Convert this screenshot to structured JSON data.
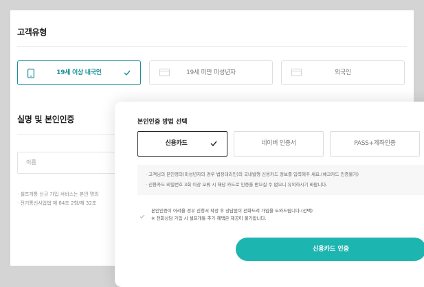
{
  "customer_type": {
    "title": "고객유형",
    "options": [
      {
        "label": "19세 이상 내국인",
        "icon": "phone-icon",
        "selected": true
      },
      {
        "label": "19세 미만 미성년자",
        "icon": "card-icon",
        "selected": false
      },
      {
        "label": "외국인",
        "icon": "card-icon",
        "selected": false
      }
    ]
  },
  "identity": {
    "title": "실명 및 본인인증",
    "name_placeholder": "이름",
    "notes": [
      "· 셀프개통 신규 가입 서비스는 본인 명의",
      "· 전기통신사업법 제 84조 2항/제 32조"
    ]
  },
  "modal": {
    "title": "본인인증 방법 선택",
    "methods": [
      {
        "label": "신용카드",
        "selected": true
      },
      {
        "label": "네이버 인증서",
        "selected": false
      },
      {
        "label": "PASS+계좌인증",
        "selected": false
      }
    ],
    "info": [
      "· 고객님의 본인명의(미성년자의 경우 법정대리인)의 국내발행 신용카드 정보를 입력해주 세요.(체크카드 인증불가)",
      "· 신용카드 비밀번호 3회 이상 오류 시 해당 카드로 인증을 받으실 수 없으니 유의하시기 바랍니다."
    ],
    "consent_lines": [
      "본인인증이 어려울 경우 신청서 작성 후 상담원이 전화드려 가입을 도와드립니다.(선택)",
      "※ 전화상담 가입 시 셀프개통 추가 혜택은 제공이 불가합니다."
    ],
    "auth_button": "신용카드 인증"
  },
  "colors": {
    "accent": "#1a8f99",
    "primary_button": "#1db5b0",
    "overlay_background": "#d4d4d4"
  }
}
